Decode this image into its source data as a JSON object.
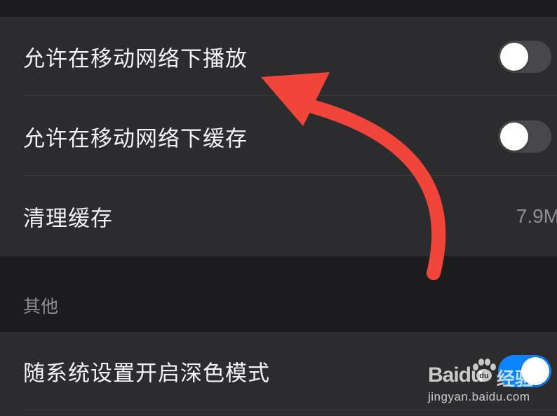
{
  "settings": {
    "group1": {
      "items": [
        {
          "label": "允许在移动网络下播放",
          "toggle_on": false
        },
        {
          "label": "允许在移动网络下缓存",
          "toggle_on": false
        },
        {
          "label": "清理缓存",
          "value": "7.9M"
        }
      ]
    },
    "section_other": {
      "title": "其他",
      "items": [
        {
          "label": "随系统设置开启深色模式",
          "toggle_on": true
        }
      ]
    }
  },
  "annotation": {
    "arrow_color": "#f1453a",
    "arrow_target": "允许在移动网络下播放"
  },
  "watermark": {
    "brand": "Baidu",
    "cn": "经验",
    "url": "jingyan.baidu.com",
    "icon": "baidu-paw-icon"
  },
  "colors": {
    "background": "#1c1c1e",
    "cell": "#2c2c2e",
    "toggle_off": "#48484a",
    "toggle_on": "#0a84ff"
  }
}
